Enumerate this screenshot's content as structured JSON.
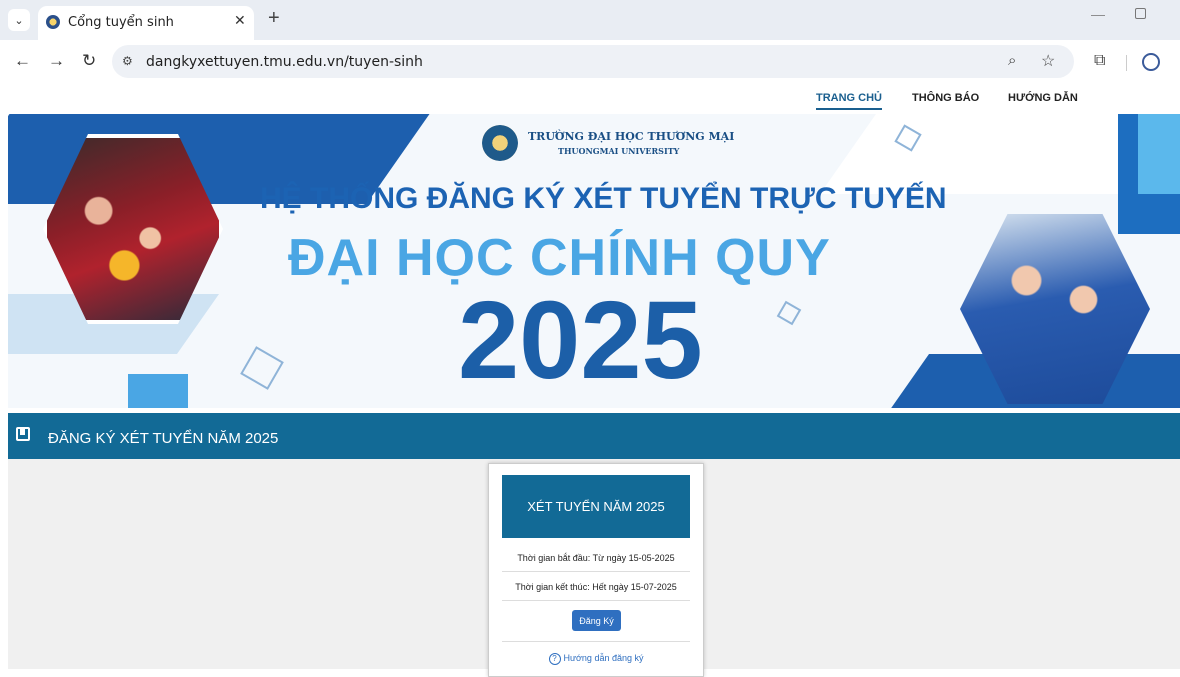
{
  "browser": {
    "tab_title": "Cổng tuyển sinh",
    "url": "dangkyxettuyen.tmu.edu.vn/tuyen-sinh"
  },
  "nav": {
    "items": [
      {
        "label": "TRANG CHỦ",
        "active": true
      },
      {
        "label": "THÔNG BÁO",
        "active": false
      },
      {
        "label": "HƯỚNG DẪN",
        "active": false
      }
    ]
  },
  "banner": {
    "university_name": "TRƯỜNG ĐẠI HỌC THƯƠNG MẠI",
    "university_name_en": "THUONGMAI UNIVERSITY",
    "headline_line1": "HỆ THỐNG ĐĂNG KÝ XÉT TUYỂN TRỰC TUYẾN",
    "headline_line2": "ĐẠI HỌC CHÍNH QUY",
    "headline_year": "2025"
  },
  "section": {
    "title": "ĐĂNG KÝ XÉT TUYỂN NĂM 2025"
  },
  "card": {
    "heading": "XÉT TUYỂN NĂM 2025",
    "start_time": "Thời gian bắt đầu: Từ ngày 15-05-2025",
    "end_time": "Thời gian kết thúc: Hết ngày 15-07-2025",
    "register_label": "Đăng Ký",
    "guide_label": "Hướng dẫn đăng ký"
  },
  "colors": {
    "primary": "#126a96",
    "button": "#2f6fc0",
    "headline_dark": "#1c5fa8",
    "headline_light": "#4aa6e4"
  }
}
